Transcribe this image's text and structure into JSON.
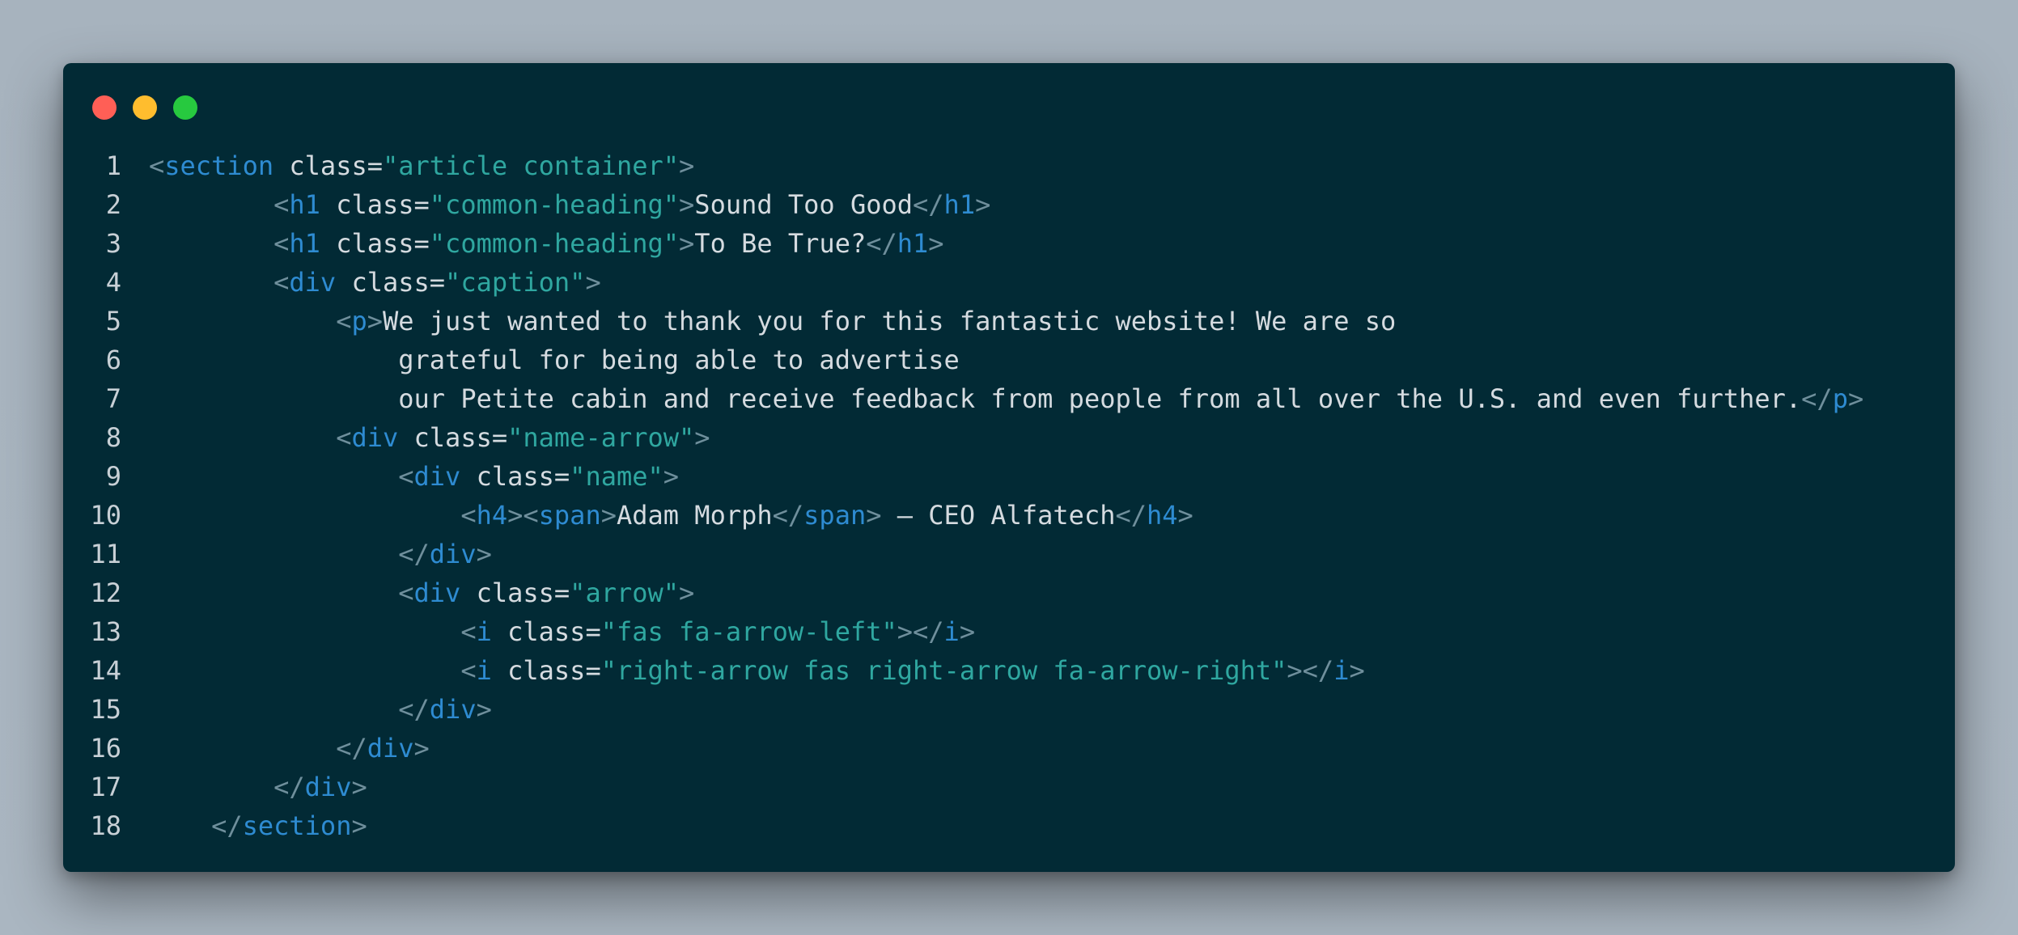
{
  "window": {
    "controls": {
      "close_color": "#ff5f56",
      "minimize_color": "#ffbd2e",
      "maximize_color": "#27c93f"
    }
  },
  "code": {
    "lines": [
      {
        "num": "1",
        "indent": "",
        "segs": [
          [
            "p",
            "<"
          ],
          [
            "t",
            "section"
          ],
          [
            "a",
            " class="
          ],
          [
            "v",
            "\"article container\""
          ],
          [
            "p",
            ">"
          ]
        ]
      },
      {
        "num": "2",
        "indent": "        ",
        "segs": [
          [
            "p",
            "<"
          ],
          [
            "t",
            "h1"
          ],
          [
            "a",
            " class="
          ],
          [
            "v",
            "\"common-heading\""
          ],
          [
            "p",
            ">"
          ],
          [
            "x",
            "Sound Too Good"
          ],
          [
            "p",
            "</"
          ],
          [
            "t",
            "h1"
          ],
          [
            "p",
            ">"
          ]
        ]
      },
      {
        "num": "3",
        "indent": "        ",
        "segs": [
          [
            "p",
            "<"
          ],
          [
            "t",
            "h1"
          ],
          [
            "a",
            " class="
          ],
          [
            "v",
            "\"common-heading\""
          ],
          [
            "p",
            ">"
          ],
          [
            "x",
            "To Be True?"
          ],
          [
            "p",
            "</"
          ],
          [
            "t",
            "h1"
          ],
          [
            "p",
            ">"
          ]
        ]
      },
      {
        "num": "4",
        "indent": "        ",
        "segs": [
          [
            "p",
            "<"
          ],
          [
            "t",
            "div"
          ],
          [
            "a",
            " class="
          ],
          [
            "v",
            "\"caption\""
          ],
          [
            "p",
            ">"
          ]
        ]
      },
      {
        "num": "5",
        "indent": "            ",
        "segs": [
          [
            "p",
            "<"
          ],
          [
            "t",
            "p"
          ],
          [
            "p",
            ">"
          ],
          [
            "x",
            "We just wanted to thank you for this fantastic website! We are so"
          ]
        ]
      },
      {
        "num": "6",
        "indent": "                ",
        "segs": [
          [
            "x",
            "grateful for being able to advertise"
          ]
        ]
      },
      {
        "num": "7",
        "indent": "                ",
        "segs": [
          [
            "x",
            "our Petite cabin and receive feedback from people from all over the U.S. and even further."
          ],
          [
            "p",
            "</"
          ],
          [
            "t",
            "p"
          ],
          [
            "p",
            ">"
          ]
        ]
      },
      {
        "num": "8",
        "indent": "            ",
        "segs": [
          [
            "p",
            "<"
          ],
          [
            "t",
            "div"
          ],
          [
            "a",
            " class="
          ],
          [
            "v",
            "\"name-arrow\""
          ],
          [
            "p",
            ">"
          ]
        ]
      },
      {
        "num": "9",
        "indent": "                ",
        "segs": [
          [
            "p",
            "<"
          ],
          [
            "t",
            "div"
          ],
          [
            "a",
            " class="
          ],
          [
            "v",
            "\"name\""
          ],
          [
            "p",
            ">"
          ]
        ]
      },
      {
        "num": "10",
        "indent": "                    ",
        "segs": [
          [
            "p",
            "<"
          ],
          [
            "t",
            "h4"
          ],
          [
            "p",
            ">"
          ],
          [
            "p",
            "<"
          ],
          [
            "t",
            "span"
          ],
          [
            "p",
            ">"
          ],
          [
            "x",
            "Adam Morph"
          ],
          [
            "p",
            "</"
          ],
          [
            "t",
            "span"
          ],
          [
            "p",
            ">"
          ],
          [
            "x",
            " — CEO Alfatech"
          ],
          [
            "p",
            "</"
          ],
          [
            "t",
            "h4"
          ],
          [
            "p",
            ">"
          ]
        ]
      },
      {
        "num": "11",
        "indent": "                ",
        "segs": [
          [
            "p",
            "</"
          ],
          [
            "t",
            "div"
          ],
          [
            "p",
            ">"
          ]
        ]
      },
      {
        "num": "12",
        "indent": "                ",
        "segs": [
          [
            "p",
            "<"
          ],
          [
            "t",
            "div"
          ],
          [
            "a",
            " class="
          ],
          [
            "v",
            "\"arrow\""
          ],
          [
            "p",
            ">"
          ]
        ]
      },
      {
        "num": "13",
        "indent": "                    ",
        "segs": [
          [
            "p",
            "<"
          ],
          [
            "t",
            "i"
          ],
          [
            "a",
            " class="
          ],
          [
            "v",
            "\"fas fa-arrow-left\""
          ],
          [
            "p",
            ">"
          ],
          [
            "p",
            "</"
          ],
          [
            "t",
            "i"
          ],
          [
            "p",
            ">"
          ]
        ]
      },
      {
        "num": "14",
        "indent": "                    ",
        "segs": [
          [
            "p",
            "<"
          ],
          [
            "t",
            "i"
          ],
          [
            "a",
            " class="
          ],
          [
            "v",
            "\"right-arrow fas right-arrow fa-arrow-right\""
          ],
          [
            "p",
            ">"
          ],
          [
            "p",
            "</"
          ],
          [
            "t",
            "i"
          ],
          [
            "p",
            ">"
          ]
        ]
      },
      {
        "num": "15",
        "indent": "                ",
        "segs": [
          [
            "p",
            "</"
          ],
          [
            "t",
            "div"
          ],
          [
            "p",
            ">"
          ]
        ]
      },
      {
        "num": "16",
        "indent": "            ",
        "segs": [
          [
            "p",
            "</"
          ],
          [
            "t",
            "div"
          ],
          [
            "p",
            ">"
          ]
        ]
      },
      {
        "num": "17",
        "indent": "        ",
        "segs": [
          [
            "p",
            "</"
          ],
          [
            "t",
            "div"
          ],
          [
            "p",
            ">"
          ]
        ]
      },
      {
        "num": "18",
        "indent": "    ",
        "segs": [
          [
            "p",
            "</"
          ],
          [
            "t",
            "section"
          ],
          [
            "p",
            ">"
          ]
        ]
      }
    ]
  }
}
